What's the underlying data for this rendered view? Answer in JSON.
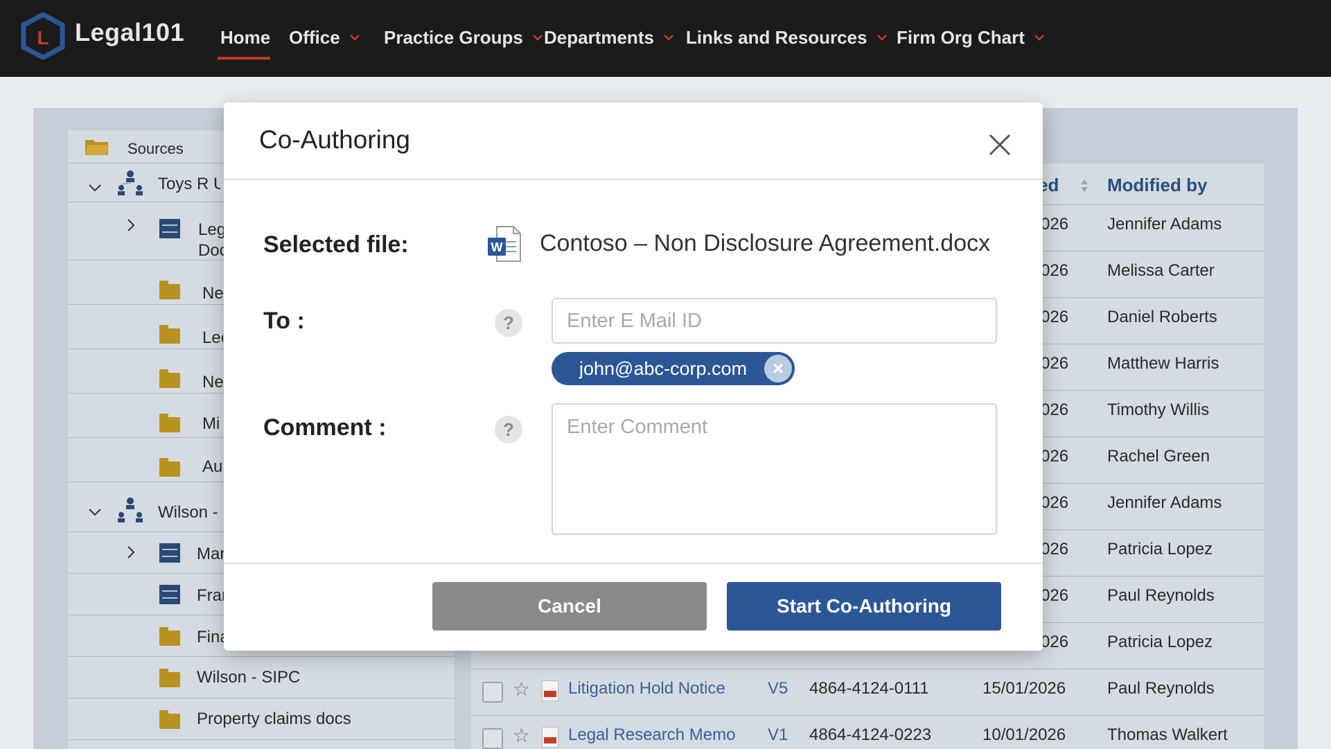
{
  "nav": {
    "brand": "Legal101",
    "logo_letter": "L",
    "items": [
      {
        "label": "Home",
        "has_dropdown": false,
        "active": true
      },
      {
        "label": "Office",
        "has_dropdown": true
      },
      {
        "label": "Practice Groups",
        "has_dropdown": true
      },
      {
        "label": "Departments",
        "has_dropdown": true
      },
      {
        "label": "Links and Resources",
        "has_dropdown": true
      },
      {
        "label": "Firm Org Chart",
        "has_dropdown": true
      }
    ]
  },
  "sidebar": {
    "header": "Sources",
    "items": [
      {
        "label": "Toys R U",
        "icon": "org-icon"
      },
      {
        "label": "Leg",
        "label2": "Doc",
        "icon": "cabinet-icon"
      },
      {
        "label": "Ne",
        "icon": "folder-icon"
      },
      {
        "label": "Lec",
        "icon": "folder-icon"
      },
      {
        "label": "Ne",
        "icon": "folder-icon"
      },
      {
        "label": "Mi",
        "icon": "folder-icon"
      },
      {
        "label": "Au",
        "icon": "folder-icon"
      },
      {
        "label": "Wilson -",
        "icon": "org-icon"
      },
      {
        "label": "Mar",
        "icon": "cabinet-icon"
      },
      {
        "label": "Frar",
        "icon": "cabinet-icon"
      },
      {
        "label": "Fina",
        "icon": "folder-icon"
      },
      {
        "label": "Wilson - SIPC",
        "icon": "folder-icon"
      },
      {
        "label": "Property claims docs",
        "icon": "folder-icon"
      }
    ]
  },
  "grid": {
    "header_partial": "ed",
    "header_modified_by": "Modified by",
    "rows": [
      {
        "date_partial": "026",
        "modified_by": "Jennifer Adams"
      },
      {
        "date_partial": "026",
        "modified_by": "Melissa Carter"
      },
      {
        "date_partial": "026",
        "modified_by": "Daniel Roberts"
      },
      {
        "date_partial": "026",
        "modified_by": "Matthew Harris"
      },
      {
        "date_partial": "026",
        "modified_by": "Timothy Willis"
      },
      {
        "date_partial": "026",
        "modified_by": "Rachel Green"
      },
      {
        "date_partial": "026",
        "modified_by": "Jennifer Adams"
      },
      {
        "date_partial": "026",
        "modified_by": "Patricia Lopez"
      },
      {
        "date_partial": "026",
        "modified_by": "Paul Reynolds"
      },
      {
        "date_partial": "026",
        "modified_by": "Patricia Lopez"
      }
    ],
    "full_rows": [
      {
        "name": "Litigation Hold Notice",
        "version": "V5",
        "doc_id": "4864-4124-0111",
        "date": "15/01/2026",
        "modified_by": "Paul Reynolds"
      },
      {
        "name": "Legal Research Memo",
        "version": "V1",
        "doc_id": "4864-4124-0223",
        "date": "10/01/2026",
        "modified_by": "Thomas Walkert"
      }
    ]
  },
  "modal": {
    "title": "Co-Authoring",
    "selected_file_label": "Selected file:",
    "file_name": "Contoso – Non Disclosure Agreement.docx",
    "file_icon_letter": "W",
    "to_label": "To :",
    "help_glyph": "?",
    "email_placeholder": "Enter E Mail ID",
    "recipients": [
      "john@abc-corp.com"
    ],
    "comment_label": "Comment :",
    "comment_placeholder": "Enter Comment",
    "cancel_label": "Cancel",
    "submit_label": "Start Co-Authoring"
  }
}
